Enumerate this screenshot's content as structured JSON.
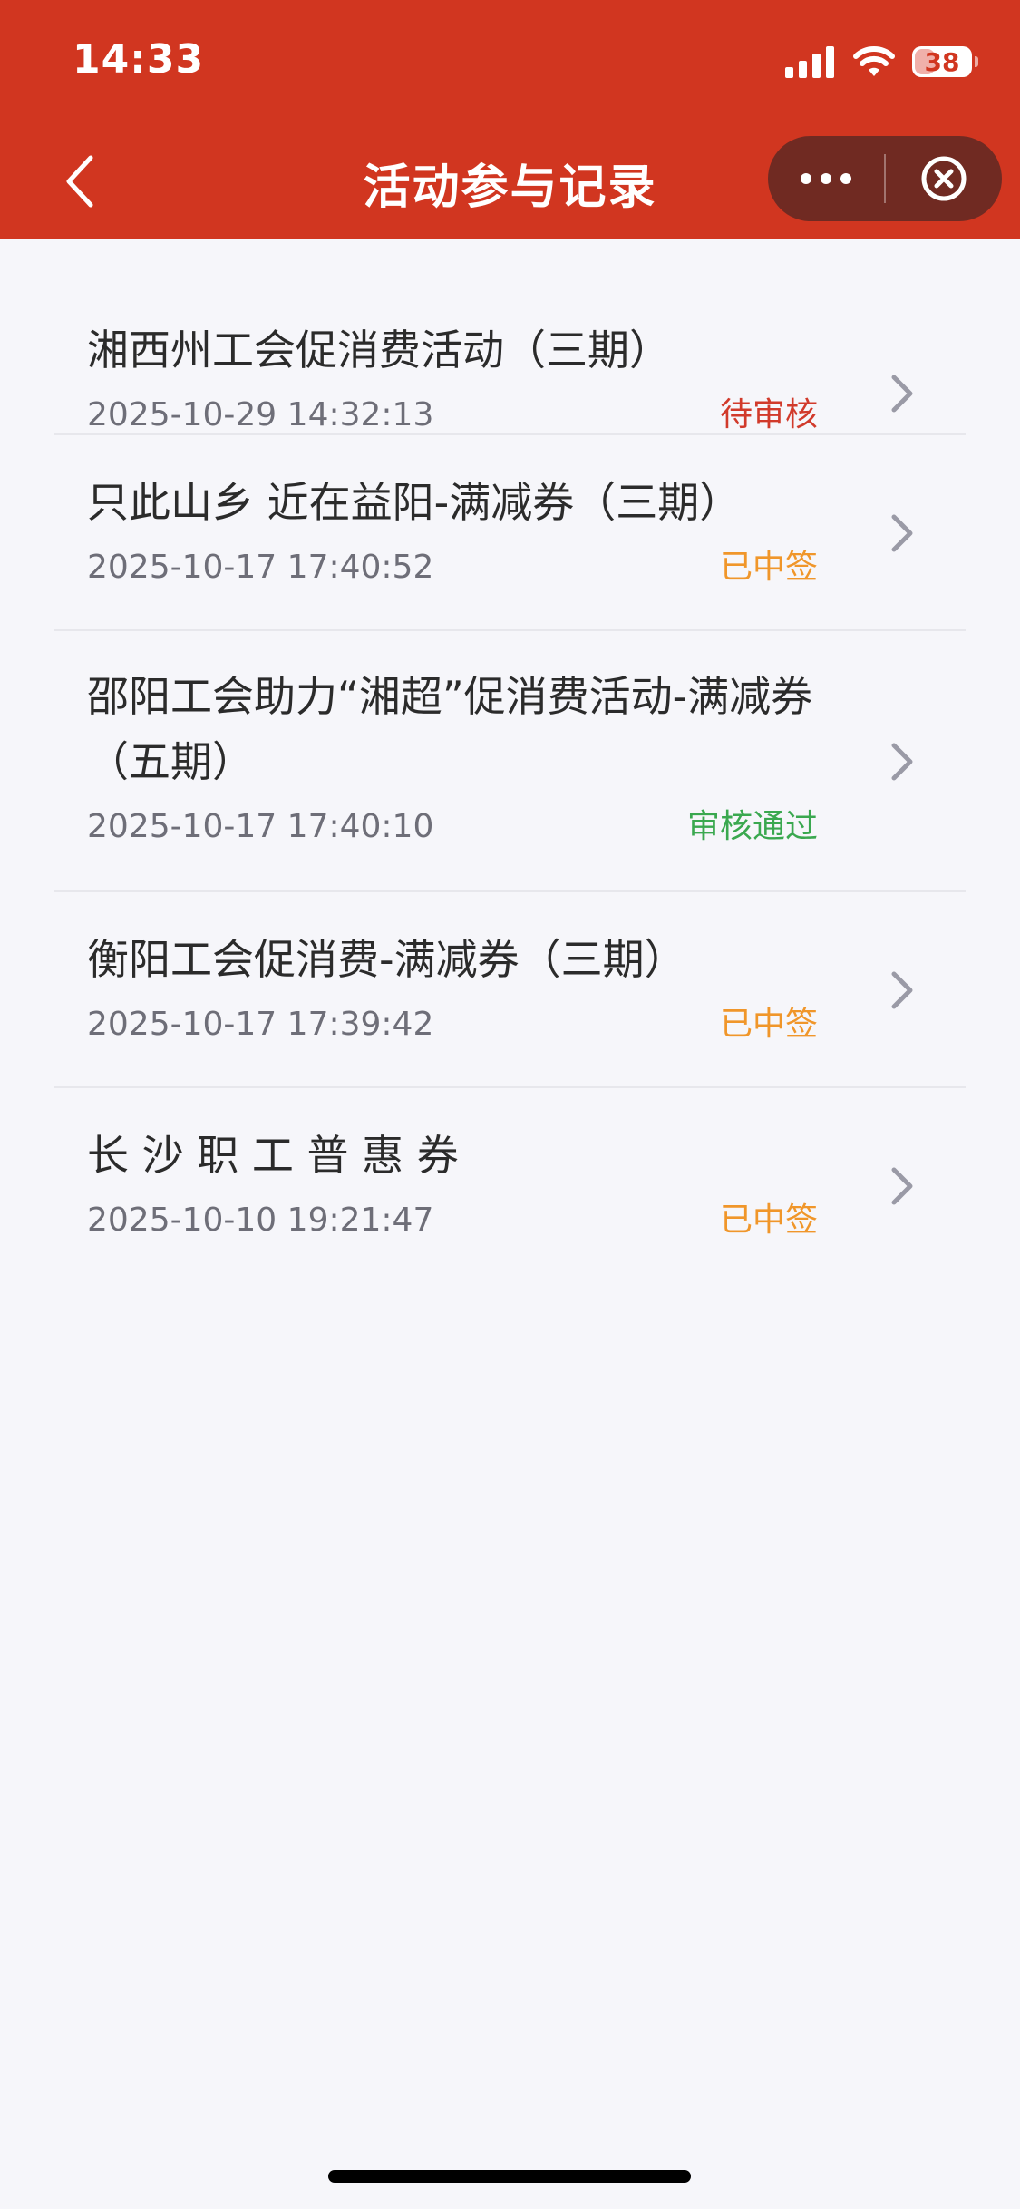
{
  "status_bar": {
    "time": "14:33",
    "battery": "38"
  },
  "nav": {
    "title": "活动参与记录"
  },
  "records": [
    {
      "title": "湘西州工会促消费活动（三期）",
      "time": "2025-10-29 14:32:13",
      "status": "待审核",
      "status_color": "#d13a2b"
    },
    {
      "title": "只此山乡 近在益阳-满减券（三期）",
      "time": "2025-10-17 17:40:52",
      "status": "已中签",
      "status_color": "#f0962a"
    },
    {
      "title": "邵阳工会助力“湘超”促消费活动-满减券（五期）",
      "time": "2025-10-17 17:40:10",
      "status": "审核通过",
      "status_color": "#3aa84f"
    },
    {
      "title": "衡阳工会促消费-满减券（三期）",
      "time": "2025-10-17 17:39:42",
      "status": "已中签",
      "status_color": "#f0962a"
    },
    {
      "title": "长 沙 职 工 普 惠 券",
      "time": "2025-10-10 19:21:47",
      "status": "已中签",
      "status_color": "#f0962a"
    }
  ],
  "colors": {
    "header": "#d13620",
    "background": "#f6f6fa"
  },
  "icons": {
    "back": "chevron-left-icon",
    "more": "more-dots-icon",
    "close": "close-circle-icon",
    "row": "chevron-right-icon"
  }
}
